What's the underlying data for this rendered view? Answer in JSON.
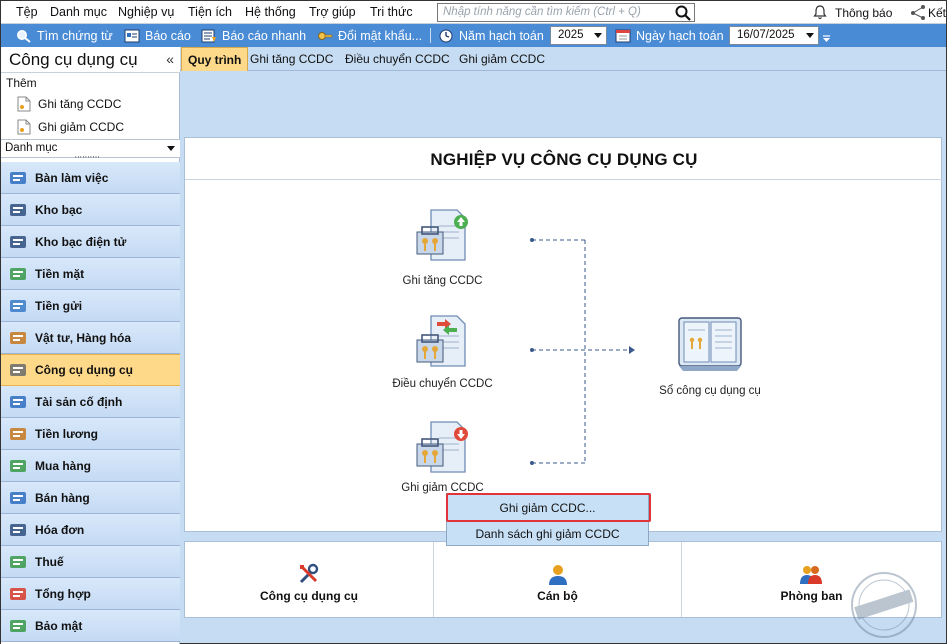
{
  "menu": [
    "Tệp",
    "Danh mục",
    "Nghiệp vụ",
    "Tiện ích",
    "Hệ thống",
    "Trợ giúp",
    "Tri thức"
  ],
  "search": {
    "placeholder": "Nhập tính năng cần tìm kiếm (Ctrl + Q)"
  },
  "topright": {
    "notifications": "Thông báo",
    "connect": "Kết"
  },
  "toolbar": {
    "find_voucher": "Tìm chứng từ",
    "report": "Báo cáo",
    "quick_report": "Báo cáo nhanh",
    "change_password": "Đổi mật khẩu...",
    "fiscal_year_label": "Năm hạch toán",
    "fiscal_year_value": "2025",
    "posting_date_label": "Ngày hạch toán",
    "posting_date_value": "16/07/2025"
  },
  "sidebar": {
    "title": "Công cụ dụng cụ",
    "collapse": "«",
    "add_label": "Thêm",
    "quick_links": [
      "Ghi tăng CCDC",
      "Ghi giảm CCDC"
    ],
    "category_value": "Danh mục",
    "splitter": "''''''''''",
    "items": [
      {
        "label": "Bàn làm việc",
        "icon": "desk-icon"
      },
      {
        "label": "Kho bạc",
        "icon": "treasury-icon"
      },
      {
        "label": "Kho bạc điện tử",
        "icon": "e-treasury-icon"
      },
      {
        "label": "Tiền mặt",
        "icon": "cash-icon"
      },
      {
        "label": "Tiền gửi",
        "icon": "deposit-icon"
      },
      {
        "label": "Vật tư, Hàng hóa",
        "icon": "goods-icon"
      },
      {
        "label": "Công cụ dụng cụ",
        "icon": "tools-icon",
        "active": true
      },
      {
        "label": "Tài sản cố định",
        "icon": "fixed-asset-icon"
      },
      {
        "label": "Tiền lương",
        "icon": "salary-icon"
      },
      {
        "label": "Mua hàng",
        "icon": "cart-icon"
      },
      {
        "label": "Bán hàng",
        "icon": "sales-icon"
      },
      {
        "label": "Hóa đơn",
        "icon": "invoice-icon"
      },
      {
        "label": "Thuế",
        "icon": "tax-icon"
      },
      {
        "label": "Tổng hợp",
        "icon": "summary-icon"
      },
      {
        "label": "Bảo mật",
        "icon": "security-icon"
      }
    ]
  },
  "tabs": [
    "Quy trình",
    "Ghi tăng CCDC",
    "Điều chuyển CCDC",
    "Ghi giảm CCDC"
  ],
  "process": {
    "title": "NGHIỆP VỤ CÔNG CỤ DỤNG CỤ",
    "increase": "Ghi tăng CCDC",
    "transfer": "Điều chuyển CCDC",
    "decrease": "Ghi giảm CCDC",
    "ledger": "Sổ công cụ dụng cụ"
  },
  "bottom": {
    "tools": "Công cụ dụng cụ",
    "staff": "Cán bộ",
    "department": "Phòng ban"
  },
  "dropdown": {
    "items": [
      "Ghi giảm CCDC...",
      "Danh sách ghi giảm CCDC"
    ]
  },
  "colors": {
    "toolbar_bg": "#4a8bd6",
    "active_nav": "#ffd98a",
    "main_bg": "#c6dcf2",
    "highlight": "#e0343a"
  }
}
